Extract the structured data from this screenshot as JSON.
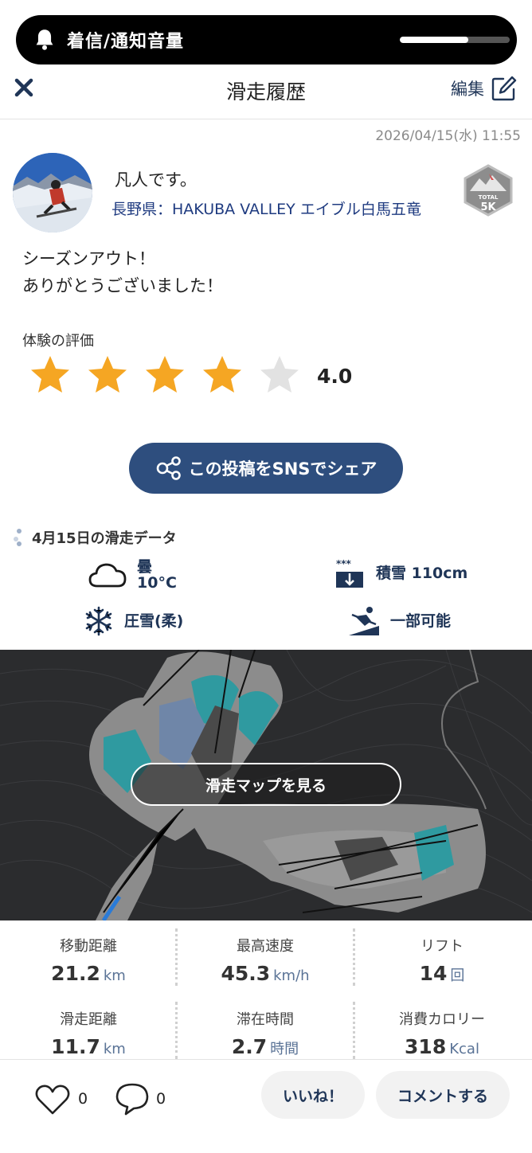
{
  "hud": {
    "label": "着信/通知音量",
    "volume_fraction": 0.62
  },
  "header": {
    "title": "滑走履歴",
    "edit_label": "編集"
  },
  "post": {
    "timestamp": "2026/04/15(水) 11:55",
    "user_name": "凡人です。",
    "location": "長野県：HAKUBA VALLEY エイブル白馬五竜",
    "badge_text": "TOTAL",
    "badge_value": "5K",
    "body": "シーズンアウト！\nありがとうございました！"
  },
  "rating": {
    "label": "体験の評価",
    "stars": 4,
    "max_stars": 5,
    "value": "4.0"
  },
  "share": {
    "label": "この投稿をSNSでシェア"
  },
  "ski_data": {
    "title": "4月15日の滑走データ",
    "weather": "曇",
    "temperature": "10°C",
    "snow_depth": "積雪 110cm",
    "snow_quality": "圧雪(柔)",
    "course_status": "一部可能"
  },
  "map": {
    "button_label": "滑走マップを見る"
  },
  "stats": [
    {
      "label": "移動距離",
      "value": "21.2",
      "unit": "km"
    },
    {
      "label": "最高速度",
      "value": "45.3",
      "unit": "km/h"
    },
    {
      "label": "リフト",
      "value": "14",
      "unit": "回"
    },
    {
      "label": "滑走距離",
      "value": "11.7",
      "unit": "km"
    },
    {
      "label": "滞在時間",
      "value": "2.7",
      "unit": "時間"
    },
    {
      "label": "消費カロリー",
      "value": "318",
      "unit": "Kcal"
    }
  ],
  "footer": {
    "like_count": "0",
    "comment_count": "0",
    "like_button": "いいね！",
    "comment_button": "コメントする"
  },
  "colors": {
    "accent": "#2e4e7e",
    "star": "#f5a623",
    "star_empty": "#e2e2e2",
    "text_link": "#1f3b80"
  }
}
